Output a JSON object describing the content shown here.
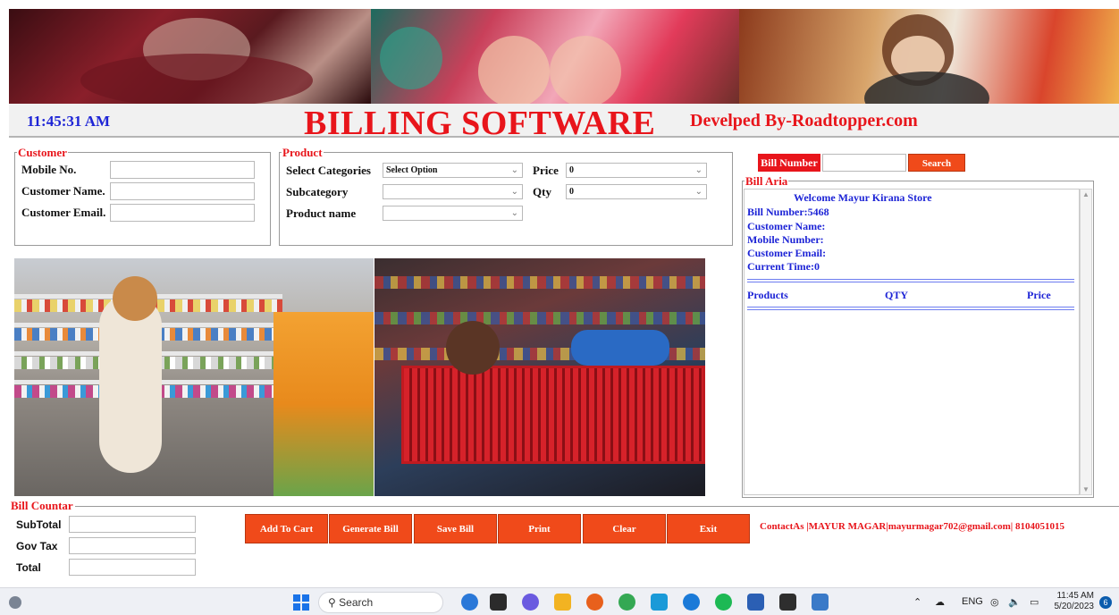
{
  "header": {
    "clock": "11:45:31 AM",
    "app_title": "BILLING SOFTWARE",
    "developer": "Develped By-Roadtopper.com"
  },
  "customer": {
    "legend": "Customer",
    "mobile_label": "Mobile No.",
    "name_label": "Customer Name.",
    "email_label": "Customer Email."
  },
  "product": {
    "legend": "Product",
    "categories_label": "Select Categories",
    "categories_value": "Select Option",
    "subcategory_label": "Subcategory",
    "product_name_label": "Product name",
    "price_label": "Price",
    "price_value": "0",
    "qty_label": "Qty",
    "qty_value": "0"
  },
  "bill_search": {
    "label": "Bill Number",
    "search_label": "Search"
  },
  "bill_area": {
    "legend": "Bill Aria",
    "welcome": "Welcome Mayur Kirana Store",
    "bill_number": "Bill Number:5468",
    "customer_name": "Customer Name:",
    "mobile_number": "Mobile Number:",
    "customer_email": "Customer Email:",
    "current_time": "Current Time:0",
    "col_products": "Products",
    "col_qty": "QTY",
    "col_price": "Price"
  },
  "bill_counter": {
    "legend": "Bill Countar",
    "subtotal_label": "SubTotal",
    "gov_tax_label": "Gov Tax",
    "total_label": "Total"
  },
  "actions": {
    "add_to_cart": "Add To Cart",
    "generate_bill": "Generate Bill",
    "save_bill": "Save Bill",
    "print": "Print",
    "clear": "Clear",
    "exit": "Exit"
  },
  "contact": "ContactAs |MAYUR MAGAR|mayurmagar702@gmail.com| 8104051015",
  "taskbar": {
    "search_label": "Search",
    "lang": "ENG",
    "time": "11:45 AM",
    "date": "5/20/2023",
    "notifications": "6"
  },
  "colors": {
    "accent_red": "#e8151b",
    "button_orange": "#f04a1a",
    "bill_text_blue": "#1d24d6"
  }
}
